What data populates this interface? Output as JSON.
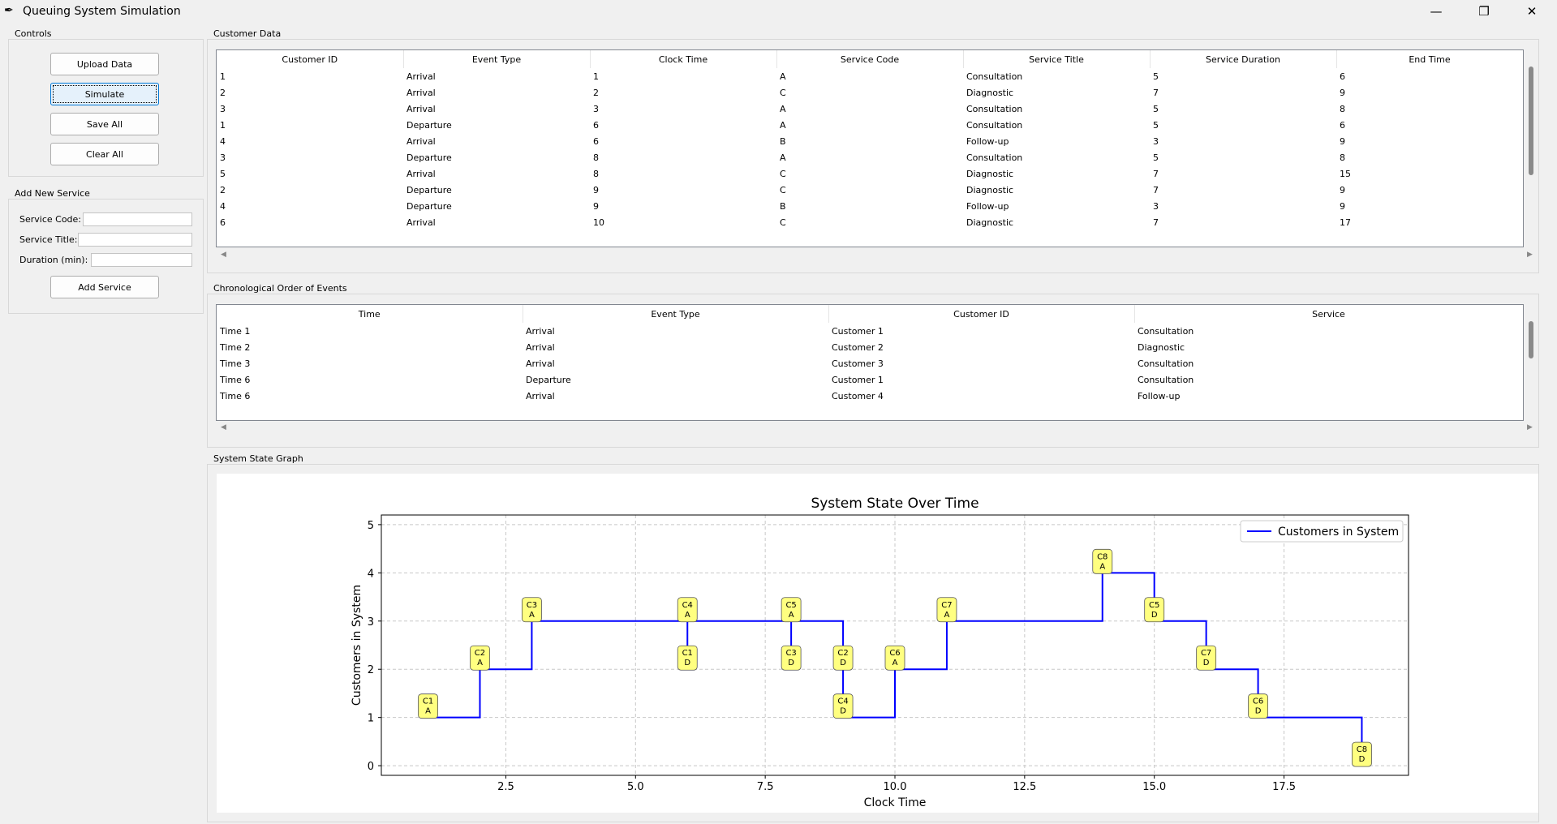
{
  "window": {
    "title": "Queuing System Simulation",
    "icon": "feather-icon"
  },
  "controls": {
    "label": "Controls",
    "upload": "Upload Data",
    "simulate": "Simulate",
    "save_all": "Save All",
    "clear_all": "Clear All"
  },
  "add_service": {
    "label": "Add New Service",
    "code_label": "Service Code:",
    "title_label": "Service Title:",
    "duration_label": "Duration (min):",
    "code_value": "",
    "title_value": "",
    "duration_value": "",
    "button": "Add Service"
  },
  "customer_data": {
    "label": "Customer Data",
    "columns": [
      "Customer ID",
      "Event Type",
      "Clock Time",
      "Service Code",
      "Service Title",
      "Service Duration",
      "End Time"
    ],
    "rows": [
      [
        "1",
        "Arrival",
        "1",
        "A",
        "Consultation",
        "5",
        "6"
      ],
      [
        "2",
        "Arrival",
        "2",
        "C",
        "Diagnostic",
        "7",
        "9"
      ],
      [
        "3",
        "Arrival",
        "3",
        "A",
        "Consultation",
        "5",
        "8"
      ],
      [
        "1",
        "Departure",
        "6",
        "A",
        "Consultation",
        "5",
        "6"
      ],
      [
        "4",
        "Arrival",
        "6",
        "B",
        "Follow-up",
        "3",
        "9"
      ],
      [
        "3",
        "Departure",
        "8",
        "A",
        "Consultation",
        "5",
        "8"
      ],
      [
        "5",
        "Arrival",
        "8",
        "C",
        "Diagnostic",
        "7",
        "15"
      ],
      [
        "2",
        "Departure",
        "9",
        "C",
        "Diagnostic",
        "7",
        "9"
      ],
      [
        "4",
        "Departure",
        "9",
        "B",
        "Follow-up",
        "3",
        "9"
      ],
      [
        "6",
        "Arrival",
        "10",
        "C",
        "Diagnostic",
        "7",
        "17"
      ]
    ]
  },
  "events": {
    "label": "Chronological Order of Events",
    "columns": [
      "Time",
      "Event Type",
      "Customer ID",
      "Service"
    ],
    "rows": [
      [
        "Time 1",
        "Arrival",
        "Customer 1",
        "Consultation"
      ],
      [
        "Time 2",
        "Arrival",
        "Customer 2",
        "Diagnostic"
      ],
      [
        "Time 3",
        "Arrival",
        "Customer 3",
        "Consultation"
      ],
      [
        "Time 6",
        "Departure",
        "Customer 1",
        "Consultation"
      ],
      [
        "Time 6",
        "Arrival",
        "Customer 4",
        "Follow-up"
      ]
    ]
  },
  "graph_frame": {
    "label": "System State Graph"
  },
  "chart_data": {
    "type": "line",
    "title": "System State Over Time",
    "xlabel": "Clock Time",
    "ylabel": "Customers in System",
    "xlim": [
      0.1,
      19.9
    ],
    "ylim": [
      -0.2,
      5.2
    ],
    "xticks": [
      2.5,
      5.0,
      7.5,
      10.0,
      12.5,
      15.0,
      17.5
    ],
    "xtick_labels": [
      "2.5",
      "5.0",
      "7.5",
      "10.0",
      "12.5",
      "15.0",
      "17.5"
    ],
    "yticks": [
      0,
      1,
      2,
      3,
      4,
      5
    ],
    "ytick_labels": [
      "0",
      "1",
      "2",
      "3",
      "4",
      "5"
    ],
    "grid": true,
    "legend_position": "top-right",
    "line_color": "#0000ff",
    "series": [
      {
        "name": "Customers in System",
        "step": "post",
        "x": [
          1,
          2,
          3,
          6,
          6,
          8,
          8,
          9,
          9,
          10,
          11,
          14,
          15,
          16,
          17,
          19
        ],
        "y": [
          1,
          2,
          3,
          2,
          3,
          2,
          3,
          2,
          1,
          2,
          3,
          4,
          3,
          2,
          1,
          0
        ]
      }
    ],
    "annotations": [
      {
        "x": 1,
        "y": 1,
        "customer": "C1",
        "event": "A"
      },
      {
        "x": 2,
        "y": 2,
        "customer": "C2",
        "event": "A"
      },
      {
        "x": 3,
        "y": 3,
        "customer": "C3",
        "event": "A"
      },
      {
        "x": 6,
        "y": 2,
        "customer": "C1",
        "event": "D"
      },
      {
        "x": 6,
        "y": 3,
        "customer": "C4",
        "event": "A"
      },
      {
        "x": 8,
        "y": 2,
        "customer": "C3",
        "event": "D"
      },
      {
        "x": 8,
        "y": 3,
        "customer": "C5",
        "event": "A"
      },
      {
        "x": 9,
        "y": 2,
        "customer": "C2",
        "event": "D"
      },
      {
        "x": 9,
        "y": 1,
        "customer": "C4",
        "event": "D"
      },
      {
        "x": 10,
        "y": 2,
        "customer": "C6",
        "event": "A"
      },
      {
        "x": 11,
        "y": 3,
        "customer": "C7",
        "event": "A"
      },
      {
        "x": 14,
        "y": 4,
        "customer": "C8",
        "event": "A"
      },
      {
        "x": 15,
        "y": 3,
        "customer": "C5",
        "event": "D"
      },
      {
        "x": 16,
        "y": 2,
        "customer": "C7",
        "event": "D"
      },
      {
        "x": 17,
        "y": 1,
        "customer": "C6",
        "event": "D"
      },
      {
        "x": 19,
        "y": 0,
        "customer": "C8",
        "event": "D"
      }
    ],
    "annotation_color": "#ffff80"
  }
}
